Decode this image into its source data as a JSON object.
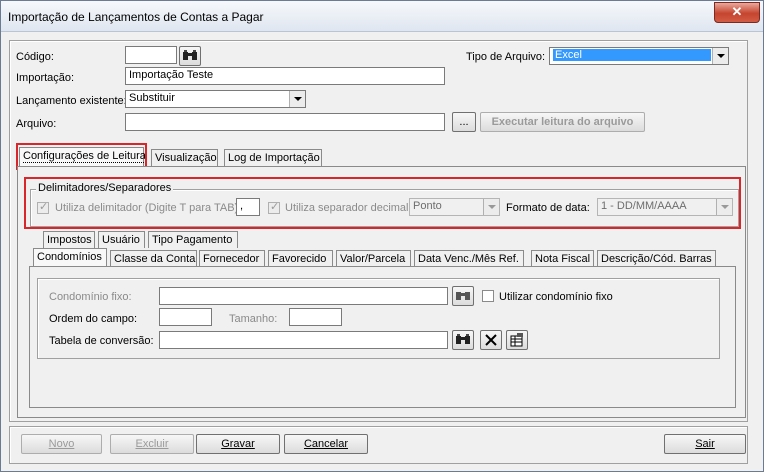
{
  "window": {
    "title": "Importação de Lançamentos de Contas a Pagar",
    "close_glyph": "✕"
  },
  "form": {
    "codigo_label": "Código:",
    "codigo_value": "",
    "importacao_label": "Importação:",
    "importacao_value": "Importação Teste",
    "lancamento_label": "Lançamento existente:",
    "lancamento_value": "Substituir",
    "arquivo_label": "Arquivo:",
    "arquivo_value": "",
    "browse_label": "...",
    "executar_label": "Executar leitura do arquivo",
    "tipo_label": "Tipo de Arquivo:",
    "tipo_value": "Excel"
  },
  "main_tabs": [
    {
      "label": "Configurações de Leitura"
    },
    {
      "label": "Visualização"
    },
    {
      "label": "Log de Importação"
    }
  ],
  "delimitadores": {
    "legend": "Delimitadores/Separadores",
    "utiliza_delim_label": "Utiliza delimitador (Digite T para TAB)",
    "delim_value": ",",
    "utiliza_sep_label": "Utiliza separador decimal",
    "sep_value": "Ponto",
    "formato_label": "Formato de data:",
    "formato_value": "1 - DD/MM/AAAA"
  },
  "sub_tabs_row1": [
    {
      "label": "Impostos"
    },
    {
      "label": "Usuário"
    },
    {
      "label": "Tipo Pagamento"
    }
  ],
  "sub_tabs_row2": [
    {
      "label": "Condomínios"
    },
    {
      "label": "Classe da Conta"
    },
    {
      "label": "Fornecedor"
    },
    {
      "label": "Favorecido"
    },
    {
      "label": "Valor/Parcela"
    },
    {
      "label": "Data Venc./Mês Ref."
    },
    {
      "label": "Nota Fiscal"
    },
    {
      "label": "Descrição/Cód. Barras"
    }
  ],
  "condominios": {
    "fixo_label": "Condomínio fixo:",
    "fixo_value": "",
    "utilizar_label": "Utilizar condomínio fixo",
    "ordem_label": "Ordem do campo:",
    "ordem_value": "",
    "tamanho_label": "Tamanho:",
    "tamanho_value": "",
    "tabela_label": "Tabela de conversão:",
    "tabela_value": ""
  },
  "buttons": {
    "novo": "Novo",
    "excluir": "Excluir",
    "gravar": "Gravar",
    "cancelar": "Cancelar",
    "sair": "Sair"
  },
  "colors": {
    "highlight": "#d9262b",
    "selection": "#3399ff"
  }
}
